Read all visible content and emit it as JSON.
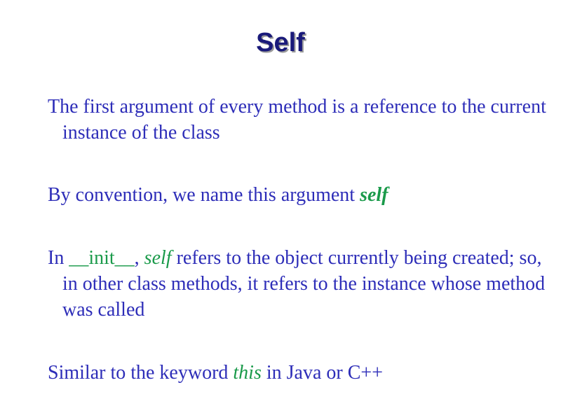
{
  "slide": {
    "title": "Self",
    "bullets": [
      {
        "text": "The first argument of every method is a reference to the current instance of the class"
      },
      {
        "prefix": "By convention, we name this argument ",
        "highlight": "self"
      },
      {
        "prefix": "In ",
        "code": "__init__",
        "comma": ", ",
        "highlight": "self",
        "suffix": " refers to the object currently being created; so, in other class methods, it refers to the instance whose method was called"
      },
      {
        "prefix": "Similar to the keyword ",
        "highlight": "this",
        "suffix": " in Java or C++"
      }
    ]
  },
  "colors": {
    "title": "#1a1a7a",
    "body_text": "#2d2db8",
    "highlight": "#1a9a4a",
    "background": "#ffffff"
  }
}
